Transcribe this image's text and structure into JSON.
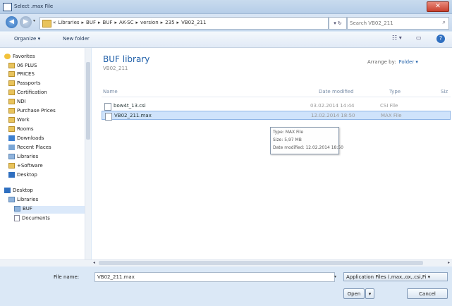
{
  "window": {
    "title": "Select .max File",
    "close_glyph": "✕"
  },
  "address": {
    "back_glyph": "◀",
    "forward_glyph": "▶",
    "dropdown_glyph": "▾",
    "breadcrumbs": [
      "«",
      "Libraries",
      "▸",
      "BUF",
      "▸",
      "BUF",
      "▸",
      "AK-SC",
      "▸",
      "version",
      "▸",
      "235",
      "▸",
      "VB02_211"
    ],
    "refresh_glyph": "▾ ↻",
    "search_placeholder": "Search VB02_211",
    "search_icon": "⌕"
  },
  "toolbar": {
    "organize": "Organize ▾",
    "new_folder": "New folder",
    "view_glyph": "☷ ▾",
    "preview_glyph": "▭",
    "help_glyph": "?"
  },
  "nav": {
    "items": [
      {
        "label": "Favorites",
        "icon": "star-icon"
      },
      {
        "label": "06 PLUS",
        "icon": "folder-icon"
      },
      {
        "label": "PRICES",
        "icon": "folder-icon"
      },
      {
        "label": "Passports",
        "icon": "folder-icon"
      },
      {
        "label": "Certification",
        "icon": "folder-icon"
      },
      {
        "label": "NDI",
        "icon": "folder-icon"
      },
      {
        "label": "Purchase Prices",
        "icon": "folder-icon"
      },
      {
        "label": "Work",
        "icon": "folder-icon"
      },
      {
        "label": "Rooms",
        "icon": "folder-icon"
      },
      {
        "label": "Downloads",
        "icon": "downloads-icon"
      },
      {
        "label": "Recent Places",
        "icon": "recent-places-icon"
      },
      {
        "label": "Libraries",
        "icon": "library-icon"
      },
      {
        "label": "+Software",
        "icon": "folder-icon"
      },
      {
        "label": "Desktop",
        "icon": "desktop-icon"
      },
      {
        "label": "Desktop",
        "icon": "desktop-icon"
      },
      {
        "label": "Libraries",
        "icon": "library-icon"
      },
      {
        "label": "BUF",
        "icon": "library-icon"
      },
      {
        "label": "Documents",
        "icon": "documents-icon"
      }
    ]
  },
  "content": {
    "library_title": "BUF library",
    "library_sub": "VB02_211",
    "arrange_label": "Arrange by:",
    "arrange_value": "Folder ▾",
    "columns": {
      "name": "Name",
      "date": "Date modified",
      "type": "Type",
      "size": "Siz"
    },
    "files": [
      {
        "name": "bow4t_13.csi",
        "date": "03.02.2014 14:44",
        "type": "CSI File"
      },
      {
        "name": "VB02_211.max",
        "date": "12.02.2014 18:50",
        "type": "MAX File"
      }
    ],
    "tooltip": {
      "type": "Type: MAX File",
      "size": "Size: 5,97 MB",
      "date": "Date modified: 12.02.2014 18:50"
    }
  },
  "scroll": {
    "left_glyph": "◂",
    "right_glyph": "▸"
  },
  "footer": {
    "filename_label": "File name:",
    "filename_value": "VB02_211.max",
    "dropdown_glyph": "▾",
    "filetype": "Application Files (.max,.ox,.csi,Fi ▾",
    "open": "Open",
    "open_dropdown": "▾",
    "cancel": "Cancel"
  },
  "colors": {
    "accent": "#1f5fa8",
    "selection": "#cfe3fb",
    "chrome": "#dbe8f6"
  }
}
